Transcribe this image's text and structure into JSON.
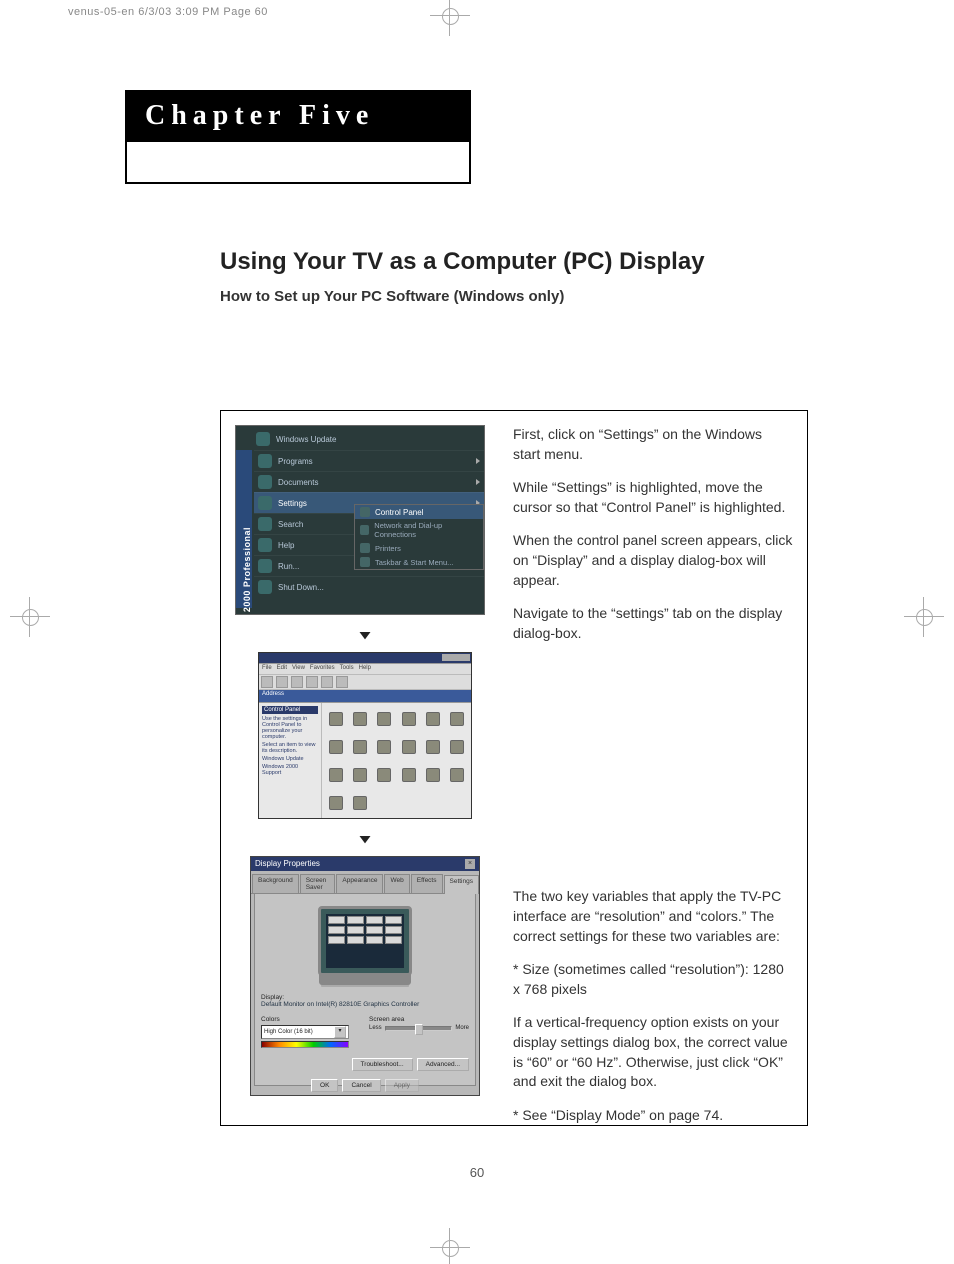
{
  "print_header": "venus-05-en  6/3/03 3:09 PM  Page 60",
  "chapter_label": "Chapter Five",
  "section_title": "Using Your TV as a Computer (PC) Display",
  "section_sub": "How to Set up Your PC Software (Windows only)",
  "steps": {
    "p1": "First, click on “Settings” on the Windows start menu.",
    "p2": "While “Settings” is highlighted, move the cursor so that “Control Panel” is highlighted.",
    "p3": "When the control panel screen appears, click on “Display” and a display dialog-box will appear.",
    "p4": "Navigate to the “settings” tab on the display dialog-box."
  },
  "details": {
    "d1": "The two key variables that apply the TV-PC interface are “resolution” and “colors.” The correct settings for these two variables are:",
    "d2": "* Size (sometimes called “resolution”): 1280 x 768 pixels",
    "d3": "If a vertical-frequency option exists on your display settings dialog box, the correct value is “60” or “60 Hz”. Otherwise, just click “OK” and exit the dialog box.",
    "d4": "* See “Display Mode” on page 74."
  },
  "start_menu": {
    "os_band": "Windows 2000 Professional",
    "top_item": "Windows Update",
    "items": {
      "programs": "Programs",
      "documents": "Documents",
      "settings": "Settings",
      "search": "Search",
      "help": "Help",
      "run": "Run...",
      "shutdown": "Shut Down..."
    },
    "submenu": {
      "title": "Control Panel",
      "net": "Network and Dial-up Connections",
      "printers": "Printers",
      "taskbar": "Taskbar & Start Menu..."
    }
  },
  "control_panel": {
    "menu": {
      "file": "File",
      "edit": "Edit",
      "view": "View",
      "favorites": "Favorites",
      "tools": "Tools",
      "help": "Help"
    },
    "address_label": "Address",
    "side_title": "Control Panel",
    "side_text1": "Use the settings in Control Panel to personalize your computer.",
    "side_text2": "Select an item to view its description.",
    "side_link1": "Windows Update",
    "side_link2": "Windows 2000 Support"
  },
  "display_props": {
    "title": "Display Properties",
    "tabs": {
      "background": "Background",
      "screensaver": "Screen Saver",
      "appearance": "Appearance",
      "web": "Web",
      "effects": "Effects",
      "settings": "Settings"
    },
    "display_label": "Display:",
    "monitor_name": "Default Monitor on Intel(R) 82810E Graphics Controller",
    "colors_label": "Colors",
    "colors_value": "High Color (16 bit)",
    "area_label": "Screen area",
    "less": "Less",
    "more": "More",
    "buttons": {
      "troubleshoot": "Troubleshoot...",
      "advanced": "Advanced...",
      "ok": "OK",
      "cancel": "Cancel",
      "apply": "Apply"
    }
  },
  "page_number": "60"
}
